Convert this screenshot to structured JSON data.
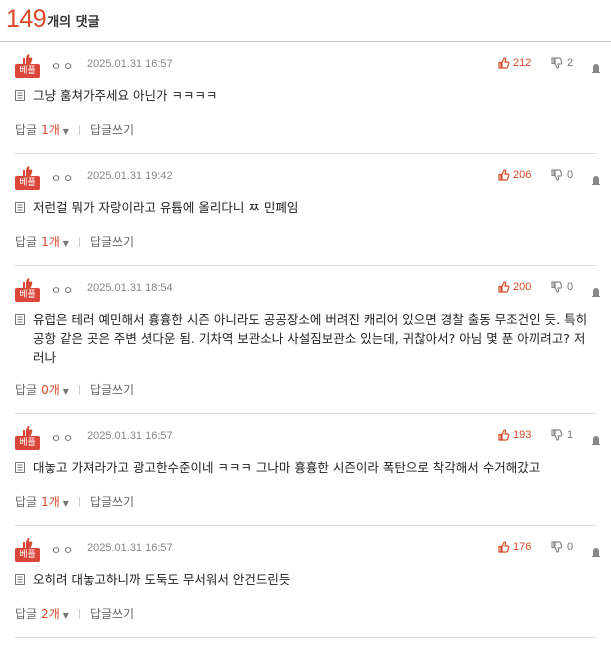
{
  "header": {
    "count": "149",
    "count_label": "개의 댓글"
  },
  "best_label": "베플",
  "comments": [
    {
      "nick": "ㅇㅇ",
      "date": "2025.01.31 16:57",
      "up": "212",
      "down": "2",
      "text": "그냥 훔쳐가주세요 아닌가 ㅋㅋㅋㅋ",
      "reply_label": "답글",
      "reply_count": "1개",
      "write_label": "답글쓰기"
    },
    {
      "nick": "ㅇㅇ",
      "date": "2025.01.31 19:42",
      "up": "206",
      "down": "0",
      "text": "저런걸 뭐가 자랑이라고 유튭에 올리다니 ㅉ 민폐임",
      "reply_label": "답글",
      "reply_count": "1개",
      "write_label": "답글쓰기"
    },
    {
      "nick": "ㅇㅇ",
      "date": "2025.01.31 18:54",
      "up": "200",
      "down": "0",
      "text": "유럽은 테러 예민해서 흉흉한 시즌 아니라도 공공장소에 버려진 캐리어 있으면 경찰 출동 무조건인 듯. 특히 공항 같은 곳은 주변 셧다운 됨. 기차역 보관소나 사설짐보관소 있는데, 귀찮아서? 아님 몇 푼 아끼려고? 저러나",
      "reply_label": "답글",
      "reply_count": "0개",
      "write_label": "답글쓰기"
    },
    {
      "nick": "ㅇㅇ",
      "date": "2025.01.31 16:57",
      "up": "193",
      "down": "1",
      "text": "대놓고 가져라가고 광고한수준이네 ㅋㅋㅋ 그나마 흉흉한 시즌이라 폭탄으로 착각해서 수거해갔고",
      "reply_label": "답글",
      "reply_count": "1개",
      "write_label": "답글쓰기"
    },
    {
      "nick": "ㅇㅇ",
      "date": "2025.01.31 16:57",
      "up": "176",
      "down": "0",
      "text": "오히려 대놓고하니까 도둑도 무서워서 안건드린듯",
      "reply_label": "답글",
      "reply_count": "2개",
      "write_label": "답글쓰기"
    }
  ],
  "icons": {
    "best": "thumbs-up-badge-icon",
    "up": "thumbs-up-icon",
    "down": "thumbs-down-icon",
    "report": "report-icon",
    "doc": "document-icon",
    "caret": "caret-down-icon"
  },
  "colors": {
    "accent": "#d84a2a",
    "badge": "#d9463a",
    "divider": "#dcdcdc"
  }
}
